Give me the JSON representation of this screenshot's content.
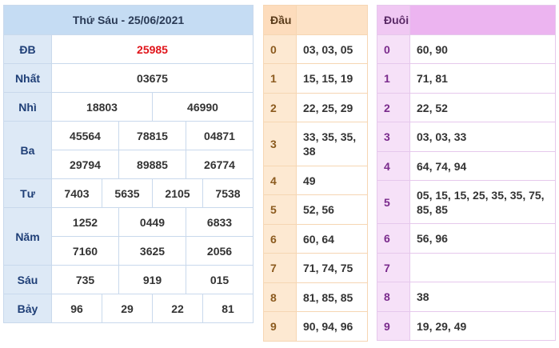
{
  "results": {
    "title": "Thứ Sáu - 25/06/2021",
    "rows": {
      "db": {
        "label": "ĐB",
        "values": [
          "25985"
        ]
      },
      "nhat": {
        "label": "Nhất",
        "values": [
          "03675"
        ]
      },
      "nhi": {
        "label": "Nhì",
        "values": [
          "18803",
          "46990"
        ]
      },
      "ba": {
        "label": "Ba",
        "values": [
          "45564",
          "78815",
          "04871",
          "29794",
          "89885",
          "26774"
        ]
      },
      "tu": {
        "label": "Tư",
        "values": [
          "7403",
          "5635",
          "2105",
          "7538"
        ]
      },
      "nam": {
        "label": "Năm",
        "values": [
          "1252",
          "0449",
          "6833",
          "7160",
          "3625",
          "2056"
        ]
      },
      "sau": {
        "label": "Sáu",
        "values": [
          "735",
          "919",
          "015"
        ]
      },
      "bay": {
        "label": "Bảy",
        "values": [
          "96",
          "29",
          "22",
          "81"
        ]
      }
    }
  },
  "head": {
    "title": "Đầu",
    "rows": [
      {
        "key": "0",
        "value": "03, 03, 05"
      },
      {
        "key": "1",
        "value": "15, 15, 19"
      },
      {
        "key": "2",
        "value": "22, 25, 29"
      },
      {
        "key": "3",
        "value": "33, 35, 35, 38"
      },
      {
        "key": "4",
        "value": "49"
      },
      {
        "key": "5",
        "value": "52, 56"
      },
      {
        "key": "6",
        "value": "60, 64"
      },
      {
        "key": "7",
        "value": "71, 74, 75"
      },
      {
        "key": "8",
        "value": "81, 85, 85"
      },
      {
        "key": "9",
        "value": "90, 94, 96"
      }
    ]
  },
  "tail": {
    "title": "Đuôi",
    "rows": [
      {
        "key": "0",
        "value": "60, 90"
      },
      {
        "key": "1",
        "value": "71, 81"
      },
      {
        "key": "2",
        "value": "22, 52"
      },
      {
        "key": "3",
        "value": "03, 03, 33"
      },
      {
        "key": "4",
        "value": "64, 74, 94"
      },
      {
        "key": "5",
        "value": "05, 15, 15, 25, 35, 35, 75, 85, 85"
      },
      {
        "key": "6",
        "value": "56, 96"
      },
      {
        "key": "7",
        "value": ""
      },
      {
        "key": "8",
        "value": "38"
      },
      {
        "key": "9",
        "value": "19, 29, 49"
      }
    ]
  }
}
